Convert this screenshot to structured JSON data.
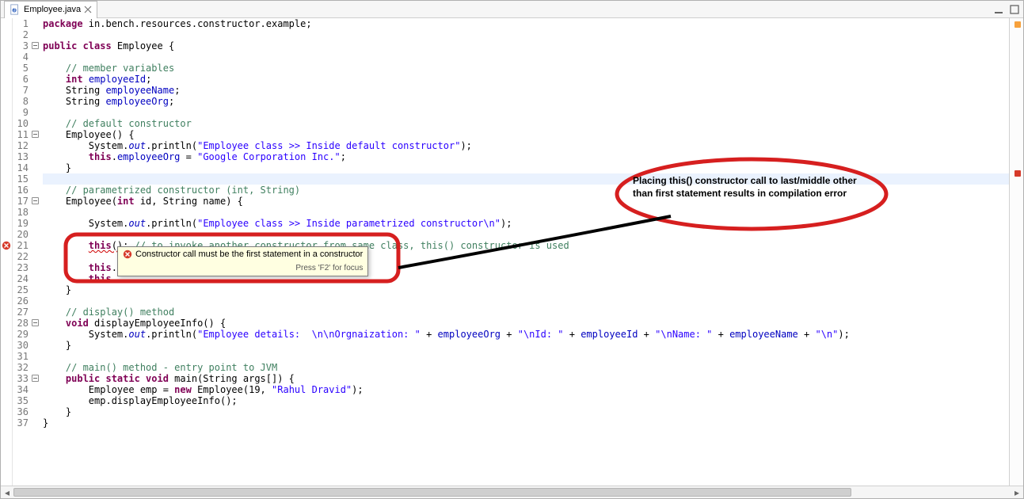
{
  "tab": {
    "filename": "Employee.java",
    "icon": "java-file-icon"
  },
  "tooltip": {
    "message": "Constructor call must be the first statement in a constructor",
    "hint": "Press 'F2' for focus"
  },
  "annotation": {
    "text": "Placing this() constructor call to last/middle other than first statement results in compilation error"
  },
  "overview": {
    "warning_color": "#f7a13b",
    "error_color": "#d63a2a"
  },
  "gutter": {
    "start": 1,
    "end": 37,
    "error_line": 21,
    "fold_lines": [
      11,
      17,
      28,
      33
    ],
    "class_fold": 3
  },
  "code": {
    "lines": [
      {
        "n": 1,
        "seg": [
          [
            "kw",
            "package"
          ],
          [
            "",
            " in.bench.resources.constructor.example;"
          ]
        ]
      },
      {
        "n": 2,
        "seg": []
      },
      {
        "n": 3,
        "seg": [
          [
            "kw",
            "public class"
          ],
          [
            "",
            " Employee {"
          ]
        ]
      },
      {
        "n": 4,
        "seg": []
      },
      {
        "n": 5,
        "seg": [
          [
            "",
            "    "
          ],
          [
            "com",
            "// member variables"
          ]
        ]
      },
      {
        "n": 6,
        "seg": [
          [
            "",
            "    "
          ],
          [
            "kw",
            "int"
          ],
          [
            "",
            " "
          ],
          [
            "fld",
            "employeeId"
          ],
          [
            "",
            ";"
          ]
        ]
      },
      {
        "n": 7,
        "seg": [
          [
            "",
            "    String "
          ],
          [
            "fld",
            "employeeName"
          ],
          [
            "",
            ";"
          ]
        ]
      },
      {
        "n": 8,
        "seg": [
          [
            "",
            "    String "
          ],
          [
            "fld",
            "employeeOrg"
          ],
          [
            "",
            ";"
          ]
        ]
      },
      {
        "n": 9,
        "seg": []
      },
      {
        "n": 10,
        "seg": [
          [
            "",
            "    "
          ],
          [
            "com",
            "// default constructor"
          ]
        ]
      },
      {
        "n": 11,
        "seg": [
          [
            "",
            "    Employee() {"
          ]
        ]
      },
      {
        "n": 12,
        "seg": [
          [
            "",
            "        System."
          ],
          [
            "sta",
            "out"
          ],
          [
            "",
            ".println("
          ],
          [
            "str",
            "\"Employee class >> Inside default constructor\""
          ],
          [
            "",
            ");"
          ]
        ]
      },
      {
        "n": 13,
        "seg": [
          [
            "",
            "        "
          ],
          [
            "kw",
            "this"
          ],
          [
            "",
            "."
          ],
          [
            "fld",
            "employeeOrg"
          ],
          [
            "",
            " = "
          ],
          [
            "str",
            "\"Google Corporation Inc.\""
          ],
          [
            "",
            ";"
          ]
        ]
      },
      {
        "n": 14,
        "seg": [
          [
            "",
            "    }"
          ]
        ]
      },
      {
        "n": 15,
        "seg": [],
        "hl": true
      },
      {
        "n": 16,
        "seg": [
          [
            "",
            "    "
          ],
          [
            "com",
            "// parametrized constructor (int, String)"
          ]
        ]
      },
      {
        "n": 17,
        "seg": [
          [
            "",
            "    Employee("
          ],
          [
            "kw",
            "int"
          ],
          [
            "",
            " id, String name) {"
          ]
        ]
      },
      {
        "n": 18,
        "seg": []
      },
      {
        "n": 19,
        "seg": [
          [
            "",
            "        System."
          ],
          [
            "sta",
            "out"
          ],
          [
            "",
            ".println("
          ],
          [
            "str",
            "\"Employee class >> Inside parametrized constructor\\n\""
          ],
          [
            "",
            ");"
          ]
        ]
      },
      {
        "n": 20,
        "seg": []
      },
      {
        "n": 21,
        "seg": [
          [
            "",
            "        "
          ],
          [
            "kw squig",
            "this"
          ],
          [
            "squig",
            "();"
          ],
          [
            "",
            " "
          ],
          [
            "com",
            "// to invoke another constructor from same class, this() constructor is used"
          ]
        ]
      },
      {
        "n": 22,
        "seg": []
      },
      {
        "n": 23,
        "seg": [
          [
            "",
            "        "
          ],
          [
            "kw",
            "this"
          ],
          [
            "",
            "."
          ]
        ]
      },
      {
        "n": 24,
        "seg": [
          [
            "",
            "        "
          ],
          [
            "kw",
            "this"
          ],
          [
            "",
            "."
          ]
        ]
      },
      {
        "n": 25,
        "seg": [
          [
            "",
            "    }"
          ]
        ]
      },
      {
        "n": 26,
        "seg": []
      },
      {
        "n": 27,
        "seg": [
          [
            "",
            "    "
          ],
          [
            "com",
            "// display() method"
          ]
        ]
      },
      {
        "n": 28,
        "seg": [
          [
            "",
            "    "
          ],
          [
            "kw",
            "void"
          ],
          [
            "",
            " displayEmployeeInfo() {"
          ]
        ]
      },
      {
        "n": 29,
        "seg": [
          [
            "",
            "        System."
          ],
          [
            "sta",
            "out"
          ],
          [
            "",
            ".println("
          ],
          [
            "str",
            "\"Employee details:  \\n\\nOrgnaization: \""
          ],
          [
            "",
            " + "
          ],
          [
            "fld",
            "employeeOrg"
          ],
          [
            "",
            " + "
          ],
          [
            "str",
            "\"\\nId: \""
          ],
          [
            "",
            " + "
          ],
          [
            "fld",
            "employeeId"
          ],
          [
            "",
            " + "
          ],
          [
            "str",
            "\"\\nName: \""
          ],
          [
            "",
            " + "
          ],
          [
            "fld",
            "employeeName"
          ],
          [
            "",
            " + "
          ],
          [
            "str",
            "\"\\n\""
          ],
          [
            "",
            ");"
          ]
        ]
      },
      {
        "n": 30,
        "seg": [
          [
            "",
            "    }"
          ]
        ]
      },
      {
        "n": 31,
        "seg": []
      },
      {
        "n": 32,
        "seg": [
          [
            "",
            "    "
          ],
          [
            "com",
            "// main() method - entry point to JVM"
          ]
        ]
      },
      {
        "n": 33,
        "seg": [
          [
            "",
            "    "
          ],
          [
            "kw",
            "public static void"
          ],
          [
            "",
            " main(String args[]) {"
          ]
        ]
      },
      {
        "n": 34,
        "seg": [
          [
            "",
            "        Employee emp = "
          ],
          [
            "kw",
            "new"
          ],
          [
            "",
            " Employee(19, "
          ],
          [
            "str",
            "\"Rahul Dravid\""
          ],
          [
            "",
            ");"
          ]
        ]
      },
      {
        "n": 35,
        "seg": [
          [
            "",
            "        emp.displayEmployeeInfo();"
          ]
        ]
      },
      {
        "n": 36,
        "seg": [
          [
            "",
            "    }"
          ]
        ]
      },
      {
        "n": 37,
        "seg": [
          [
            "",
            "}"
          ]
        ]
      }
    ]
  }
}
